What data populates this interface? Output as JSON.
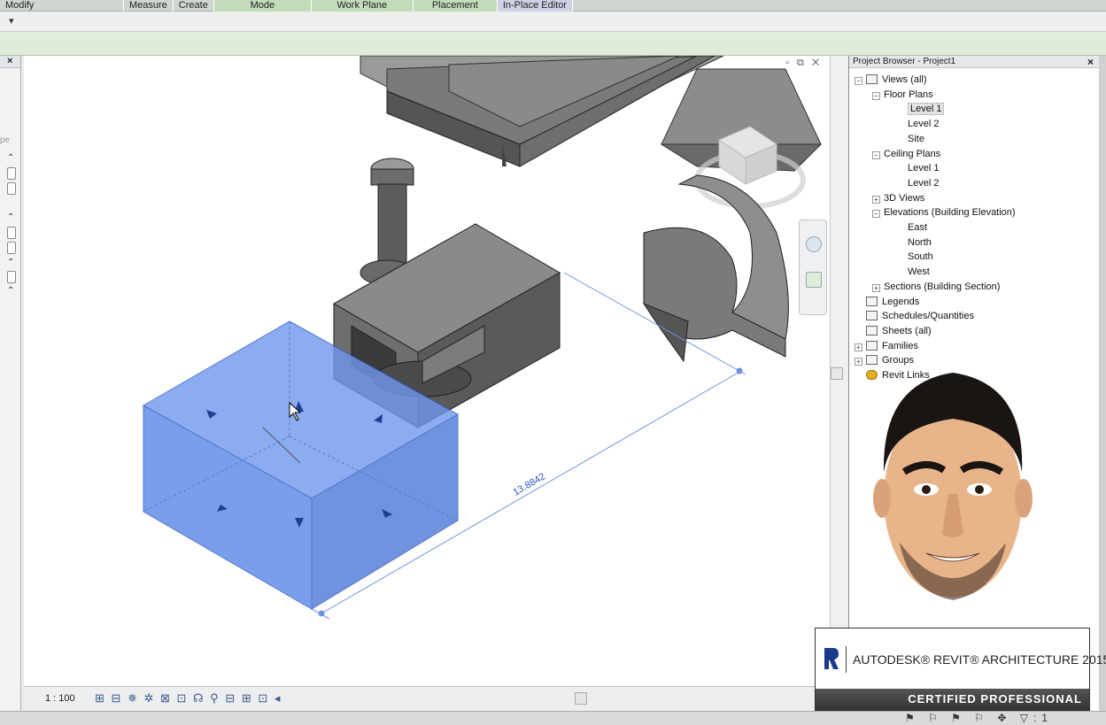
{
  "ribbon": {
    "tabs": [
      {
        "label": "Modify",
        "style": "plain"
      },
      {
        "label": "Measure",
        "style": "plain"
      },
      {
        "label": "Create",
        "style": "plain"
      },
      {
        "label": "Mode",
        "style": "green"
      },
      {
        "label": "Work Plane",
        "style": "green"
      },
      {
        "label": "Placement",
        "style": "green"
      },
      {
        "label": "In-Place Editor",
        "style": "lav"
      }
    ]
  },
  "quickbar": {
    "chevron": "▾"
  },
  "left_panel": {
    "close": "×",
    "partial_text": "pe"
  },
  "canvas": {
    "dimension_label": "13.8842",
    "view_controls": "▫ ⧉ ✕",
    "selection_color": "#5b86e6"
  },
  "status_bar": {
    "scale": "1 : 100",
    "icons": "⊞ ⊟ ✵ ✲ ⊠ ⊡ ☊ ⚲ ⊟ ⊞ ⊡ ◂"
  },
  "project_browser": {
    "title": "Project Browser - Project1",
    "close": "×",
    "nodes": [
      {
        "label": "Views (all)",
        "indent": 0,
        "toggle": "−",
        "icon": "views"
      },
      {
        "label": "Floor Plans",
        "indent": 1,
        "toggle": "−"
      },
      {
        "label": "Level 1",
        "indent": 2,
        "selected": true
      },
      {
        "label": "Level 2",
        "indent": 2
      },
      {
        "label": "Site",
        "indent": 2
      },
      {
        "label": "Ceiling Plans",
        "indent": 1,
        "toggle": "−"
      },
      {
        "label": "Level 1",
        "indent": 2
      },
      {
        "label": "Level 2",
        "indent": 2
      },
      {
        "label": "3D Views",
        "indent": 1,
        "toggle": "+"
      },
      {
        "label": "Elevations (Building Elevation)",
        "indent": 1,
        "toggle": "−"
      },
      {
        "label": "East",
        "indent": 2
      },
      {
        "label": "North",
        "indent": 2
      },
      {
        "label": "South",
        "indent": 2
      },
      {
        "label": "West",
        "indent": 2
      },
      {
        "label": "Sections (Building Section)",
        "indent": 1,
        "toggle": "+"
      },
      {
        "label": "Legends",
        "indent": 0,
        "icon": "legend"
      },
      {
        "label": "Schedules/Quantities",
        "indent": 0,
        "icon": "schedule"
      },
      {
        "label": "Sheets (all)",
        "indent": 0,
        "icon": "sheet"
      },
      {
        "label": "Families",
        "indent": 0,
        "toggle": "+",
        "icon": "family"
      },
      {
        "label": "Groups",
        "indent": 0,
        "toggle": "+",
        "icon": "group"
      },
      {
        "label": "Revit Links",
        "indent": 0,
        "icon": "link"
      }
    ]
  },
  "certificate": {
    "title": "AUTODESK® REVIT® ARCHITECTURE 2015",
    "footer": "CERTIFIED PROFESSIONAL",
    "brand_color": "#1a3a8a"
  },
  "bottom_bar": {
    "icons": "⚑ ⚐ ⚑ ⚐ ✥ ▽:1"
  }
}
